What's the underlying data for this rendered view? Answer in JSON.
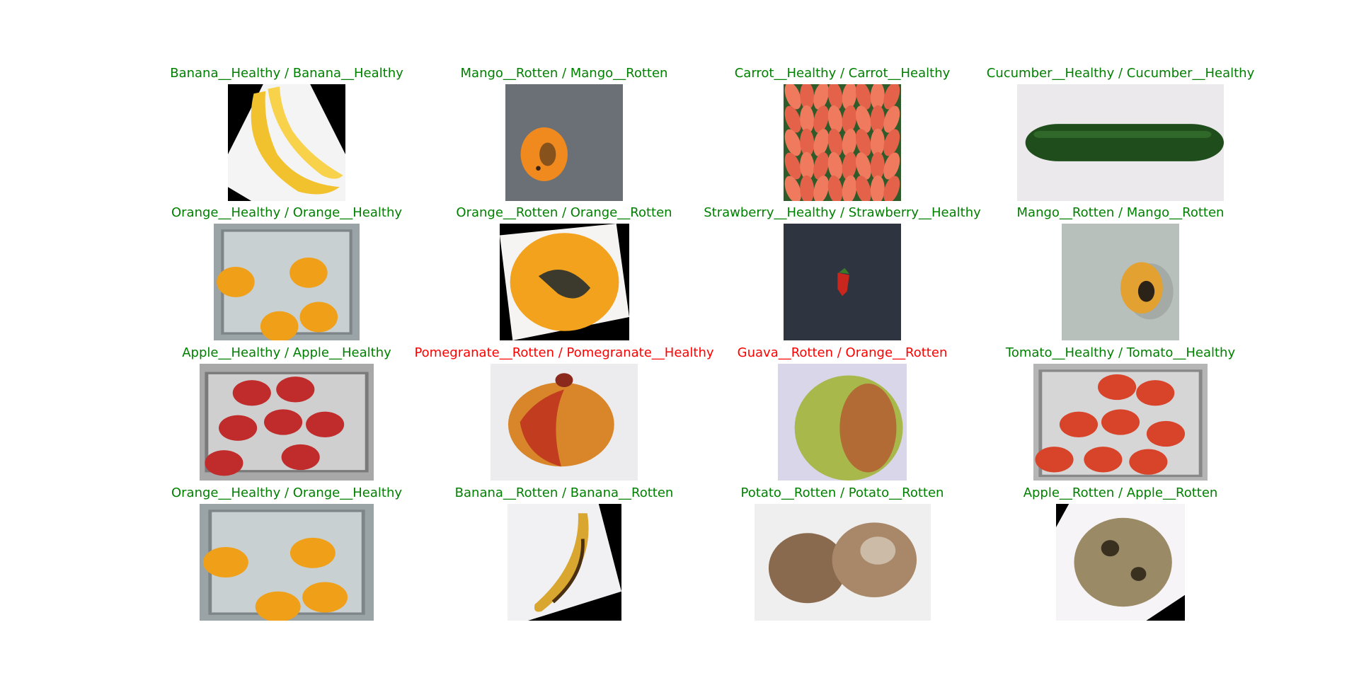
{
  "colors": {
    "correct": "#008000",
    "incorrect": "#ff0000"
  },
  "samples": [
    {
      "label": "Banana__Healthy / Banana__Healthy",
      "correct": true,
      "subject": "banana-healthy"
    },
    {
      "label": "Mango__Rotten / Mango__Rotten",
      "correct": true,
      "subject": "mango-rotten"
    },
    {
      "label": "Carrot__Healthy / Carrot__Healthy",
      "correct": true,
      "subject": "carrot-healthy"
    },
    {
      "label": "Cucumber__Healthy / Cucumber__Healthy",
      "correct": true,
      "subject": "cucumber-healthy"
    },
    {
      "label": "Orange__Healthy / Orange__Healthy",
      "correct": true,
      "subject": "orange-tray"
    },
    {
      "label": "Orange__Rotten / Orange__Rotten",
      "correct": true,
      "subject": "orange-rotten"
    },
    {
      "label": "Strawberry__Healthy / Strawberry__Healthy",
      "correct": true,
      "subject": "strawberry-healthy"
    },
    {
      "label": "Mango__Rotten / Mango__Rotten",
      "correct": true,
      "subject": "mango-rotten-2"
    },
    {
      "label": "Apple__Healthy / Apple__Healthy",
      "correct": true,
      "subject": "apple-tray"
    },
    {
      "label": "Pomegranate__Rotten / Pomegranate__Healthy",
      "correct": false,
      "subject": "pomegranate"
    },
    {
      "label": "Guava__Rotten / Orange__Rotten",
      "correct": false,
      "subject": "guava"
    },
    {
      "label": "Tomato__Healthy / Tomato__Healthy",
      "correct": true,
      "subject": "tomato-tray"
    },
    {
      "label": "Orange__Healthy / Orange__Healthy",
      "correct": true,
      "subject": "orange-tray-2"
    },
    {
      "label": "Banana__Rotten / Banana__Rotten",
      "correct": true,
      "subject": "banana-rotten"
    },
    {
      "label": "Potato__Rotten / Potato__Rotten",
      "correct": true,
      "subject": "potato-rotten"
    },
    {
      "label": "Apple__Rotten / Apple__Rotten",
      "correct": true,
      "subject": "apple-rotten"
    }
  ]
}
